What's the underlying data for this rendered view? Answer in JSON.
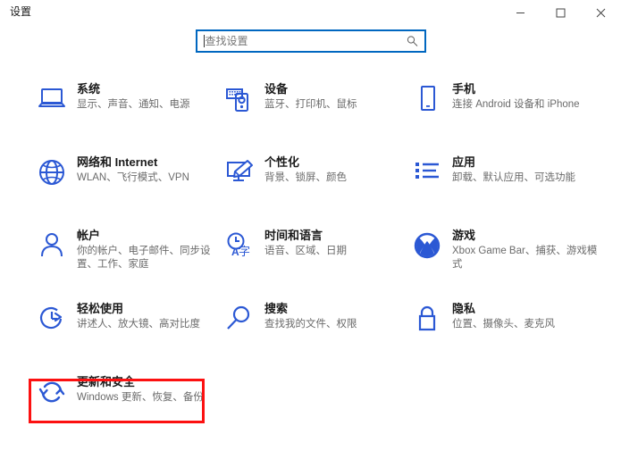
{
  "window": {
    "title": "设置",
    "controls": [
      {
        "name": "minimize",
        "glyph": "minimize-icon"
      },
      {
        "name": "maximize",
        "glyph": "maximize-icon"
      },
      {
        "name": "close",
        "glyph": "close-icon"
      }
    ]
  },
  "search": {
    "placeholder": "查找设置",
    "value": "",
    "icon": "search-icon"
  },
  "colors": {
    "icon_blue": "#2b58d4",
    "accent_border": "#0067c0",
    "highlight_red": "#fc1111",
    "title_text": "#1a1a1a",
    "sub_text": "#6b6b6b"
  },
  "tiles": [
    {
      "id": "system",
      "icon": "laptop-icon",
      "title": "系统",
      "subtitle": "显示、声音、通知、电源"
    },
    {
      "id": "devices",
      "icon": "devices-icon",
      "title": "设备",
      "subtitle": "蓝牙、打印机、鼠标"
    },
    {
      "id": "phone",
      "icon": "phone-icon",
      "title": "手机",
      "subtitle": "连接 Android 设备和 iPhone"
    },
    {
      "id": "network",
      "icon": "globe-icon",
      "title": "网络和 Internet",
      "subtitle": "WLAN、飞行模式、VPN"
    },
    {
      "id": "personalization",
      "icon": "brush-monitor-icon",
      "title": "个性化",
      "subtitle": "背景、锁屏、颜色"
    },
    {
      "id": "apps",
      "icon": "list-icon",
      "title": "应用",
      "subtitle": "卸载、默认应用、可选功能"
    },
    {
      "id": "accounts",
      "icon": "person-icon",
      "title": "帐户",
      "subtitle": "你的帐户、电子邮件、同步设置、工作、家庭"
    },
    {
      "id": "time-language",
      "icon": "clock-language-icon",
      "title": "时间和语言",
      "subtitle": "语音、区域、日期"
    },
    {
      "id": "gaming",
      "icon": "xbox-icon",
      "title": "游戏",
      "subtitle": "Xbox Game Bar、捕获、游戏模式"
    },
    {
      "id": "ease-of-access",
      "icon": "ease-of-access-icon",
      "title": "轻松使用",
      "subtitle": "讲述人、放大镜、高对比度"
    },
    {
      "id": "search",
      "icon": "magnifier-icon",
      "title": "搜索",
      "subtitle": "查找我的文件、权限"
    },
    {
      "id": "privacy",
      "icon": "lock-icon",
      "title": "隐私",
      "subtitle": "位置、摄像头、麦克风"
    },
    {
      "id": "update-security",
      "icon": "refresh-icon",
      "title": "更新和安全",
      "subtitle": "Windows 更新、恢复、备份",
      "highlighted": true
    }
  ]
}
